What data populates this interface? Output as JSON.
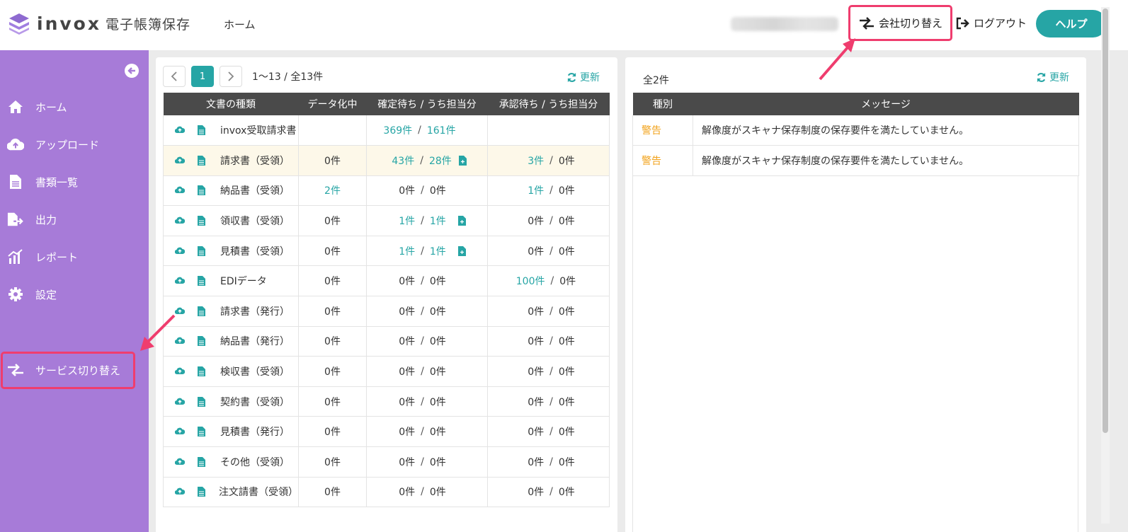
{
  "header": {
    "logo_word": "invox",
    "logo_sub": "電子帳簿保存",
    "home": "ホーム",
    "company_switch": "会社切り替え",
    "logout": "ログアウト",
    "help": "ヘルプ"
  },
  "sidebar": {
    "items": [
      {
        "label": "ホーム",
        "icon": "home-icon"
      },
      {
        "label": "アップロード",
        "icon": "cloud-upload-icon"
      },
      {
        "label": "書類一覧",
        "icon": "document-list-icon"
      },
      {
        "label": "出力",
        "icon": "export-icon"
      },
      {
        "label": "レポート",
        "icon": "report-icon"
      },
      {
        "label": "設定",
        "icon": "gear-icon"
      }
    ],
    "service_switch": "サービス切り替え"
  },
  "left": {
    "page": "1",
    "range": "1〜13 / 全13件",
    "refresh": "更新",
    "columns": [
      "文書の種類",
      "データ化中",
      "確定待ち / うち担当分",
      "承認待ち / うち担当分"
    ],
    "rows": [
      {
        "name": "invox受取請求書",
        "data": "",
        "c1": "369件",
        "c2": "161件",
        "a1": "",
        "a2": "",
        "hl": false
      },
      {
        "name": "請求書（受領）",
        "data": "0件",
        "c1": "43件",
        "c2": "28件",
        "a1": "3件",
        "a2": "0件",
        "hl": true
      },
      {
        "name": "納品書（受領）",
        "data": "2件",
        "c1": "0件",
        "c2": "0件",
        "a1": "1件",
        "a2": "0件",
        "hl": false
      },
      {
        "name": "領収書（受領）",
        "data": "0件",
        "c1": "1件",
        "c2": "1件",
        "a1": "0件",
        "a2": "0件",
        "hl": false
      },
      {
        "name": "見積書（受領）",
        "data": "0件",
        "c1": "1件",
        "c2": "1件",
        "a1": "0件",
        "a2": "0件",
        "hl": false
      },
      {
        "name": "EDIデータ",
        "data": "0件",
        "c1": "0件",
        "c2": "0件",
        "a1": "100件",
        "a2": "0件",
        "hl": false
      },
      {
        "name": "請求書（発行）",
        "data": "0件",
        "c1": "0件",
        "c2": "0件",
        "a1": "0件",
        "a2": "0件",
        "hl": false
      },
      {
        "name": "納品書（発行）",
        "data": "0件",
        "c1": "0件",
        "c2": "0件",
        "a1": "0件",
        "a2": "0件",
        "hl": false
      },
      {
        "name": "検収書（受領）",
        "data": "0件",
        "c1": "0件",
        "c2": "0件",
        "a1": "0件",
        "a2": "0件",
        "hl": false
      },
      {
        "name": "契約書（受領）",
        "data": "0件",
        "c1": "0件",
        "c2": "0件",
        "a1": "0件",
        "a2": "0件",
        "hl": false
      },
      {
        "name": "見積書（発行）",
        "data": "0件",
        "c1": "0件",
        "c2": "0件",
        "a1": "0件",
        "a2": "0件",
        "hl": false
      },
      {
        "name": "その他（受領）",
        "data": "0件",
        "c1": "0件",
        "c2": "0件",
        "a1": "0件",
        "a2": "0件",
        "hl": false
      },
      {
        "name": "注文請書（受領）",
        "data": "0件",
        "c1": "0件",
        "c2": "0件",
        "a1": "0件",
        "a2": "0件",
        "hl": false
      }
    ]
  },
  "right": {
    "total": "全2件",
    "refresh": "更新",
    "columns": [
      "種別",
      "メッセージ"
    ],
    "rows": [
      {
        "type": "警告",
        "message": "解像度がスキャナ保存制度の保存要件を満たしていません。"
      },
      {
        "type": "警告",
        "message": "解像度がスキャナ保存制度の保存要件を満たしていません。"
      }
    ]
  },
  "colors": {
    "sidebar": "#a77bd8",
    "accent": "#26a5a5",
    "header_table": "#4a4a4a",
    "warning": "#f2a31c",
    "highlight": "#ef3d6e"
  }
}
